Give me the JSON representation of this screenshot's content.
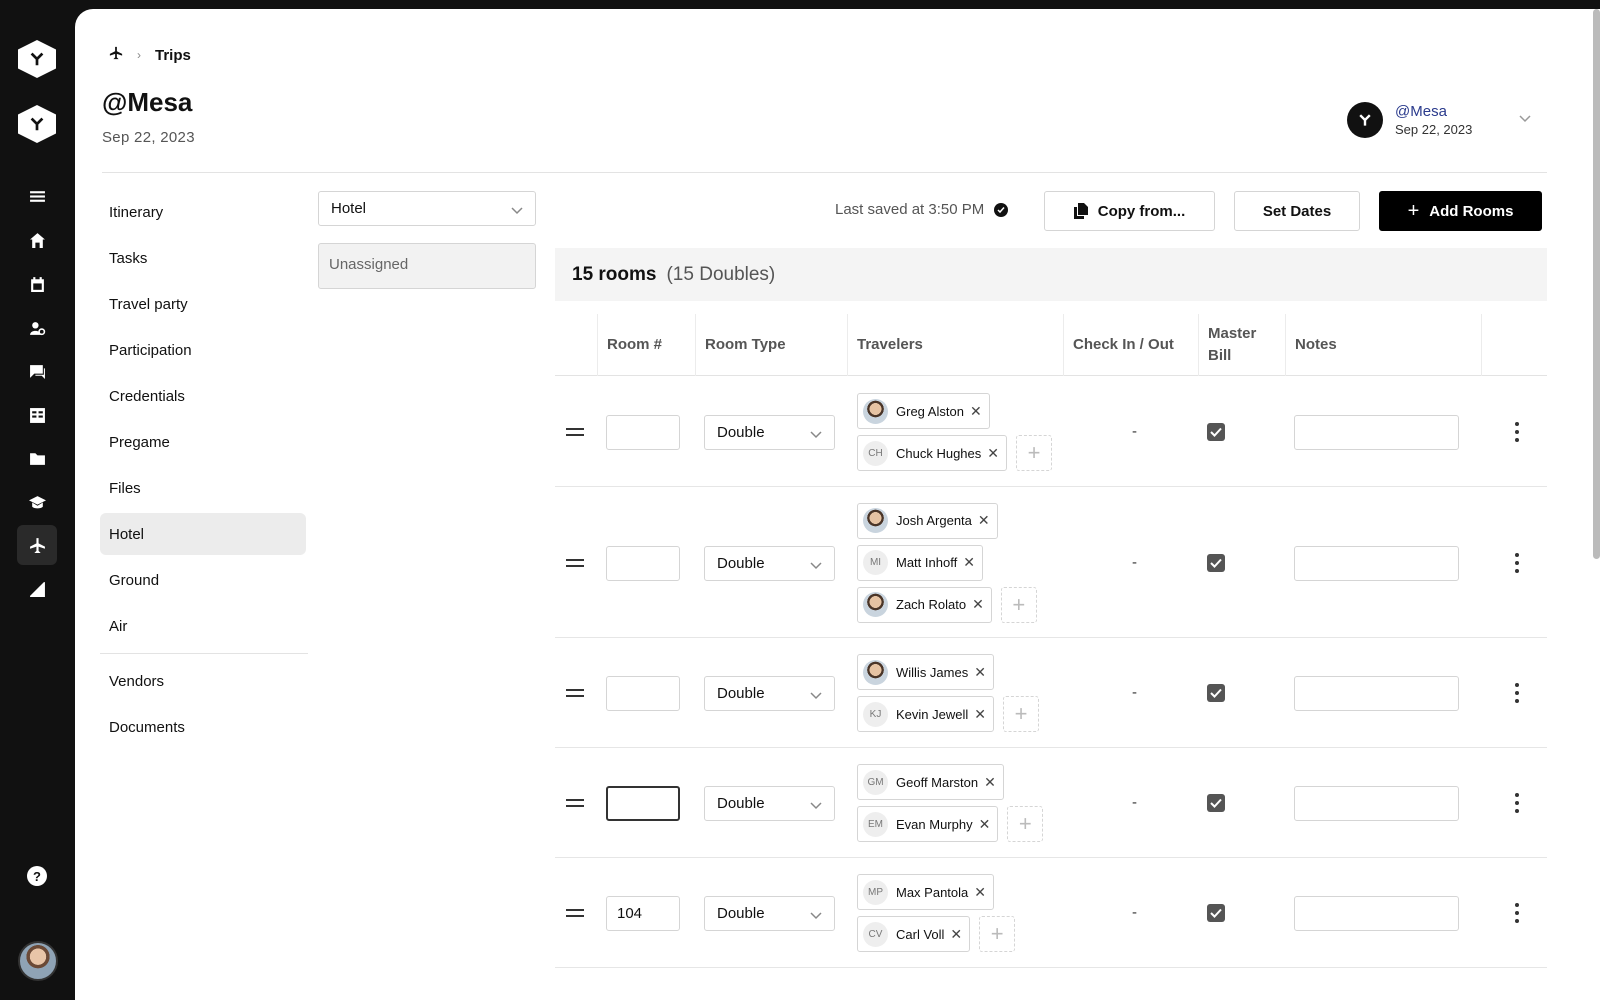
{
  "rail": {
    "logos": [
      "logo-top",
      "logo-second"
    ],
    "icons": [
      "menu-icon",
      "home-icon",
      "calendar-icon",
      "user-search-icon",
      "chat-icon",
      "table-icon",
      "folder-icon",
      "graduation-icon",
      "plane-icon",
      "chart-icon"
    ],
    "active": "plane-icon",
    "help": "?"
  },
  "breadcrumb": {
    "current": "Trips"
  },
  "page": {
    "title": "@Mesa",
    "date": "Sep 22, 2023"
  },
  "account": {
    "name": "@Mesa",
    "date": "Sep 22, 2023"
  },
  "leftnav": {
    "group1": [
      "Itinerary",
      "Tasks",
      "Travel party",
      "Participation",
      "Credentials",
      "Pregame",
      "Files",
      "Hotel",
      "Ground",
      "Air"
    ],
    "group2": [
      "Vendors",
      "Documents"
    ],
    "active": "Hotel"
  },
  "filter": {
    "selected": "Hotel",
    "unassigned": "Unassigned"
  },
  "toolbar": {
    "saved": "Last saved at 3:50 PM",
    "copy_label": "Copy from...",
    "dates_label": "Set Dates",
    "add_label": "Add Rooms"
  },
  "summary": {
    "count": "15 rooms",
    "breakdown": "(15 Doubles)"
  },
  "columns": [
    "Room #",
    "Room Type",
    "Travelers",
    "Check In / Out",
    "Master Bill",
    "Notes"
  ],
  "rows": [
    {
      "room": "",
      "type": "Double",
      "check": "-",
      "master_bill": true,
      "travelers": [
        [
          "Greg Alston"
        ],
        [
          "Chuck Hughes"
        ]
      ],
      "initials": [
        [
          "photo"
        ],
        [
          "CH"
        ]
      ]
    },
    {
      "room": "",
      "type": "Double",
      "check": "-",
      "master_bill": true,
      "travelers": [
        [
          "Josh Argenta"
        ],
        [
          "Matt Inhoff"
        ],
        [
          "Zach Rolato"
        ]
      ],
      "initials": [
        [
          "photo"
        ],
        [
          "MI"
        ],
        [
          "photo"
        ]
      ]
    },
    {
      "room": "",
      "type": "Double",
      "check": "-",
      "master_bill": true,
      "travelers": [
        [
          "Willis James"
        ],
        [
          "Kevin Jewell"
        ]
      ],
      "initials": [
        [
          "photo"
        ],
        [
          "KJ"
        ]
      ]
    },
    {
      "room": "",
      "type": "Double",
      "check": "-",
      "master_bill": true,
      "travelers": [
        [
          "Geoff Marston"
        ],
        [
          "Evan Murphy"
        ]
      ],
      "initials": [
        [
          "GM"
        ],
        [
          "EM"
        ]
      ]
    },
    {
      "room": "104",
      "type": "Double",
      "check": "-",
      "master_bill": true,
      "travelers": [
        [
          "Max Pantola"
        ],
        [
          "Carl Voll"
        ]
      ],
      "initials": [
        [
          "MP"
        ],
        [
          "CV"
        ]
      ]
    }
  ]
}
